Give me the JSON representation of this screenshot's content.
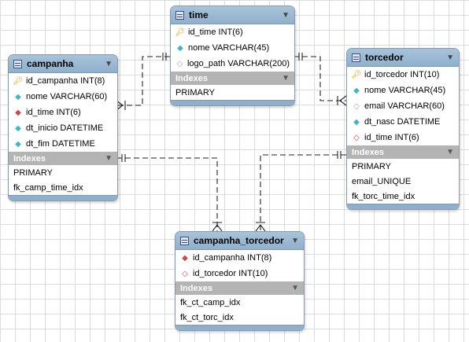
{
  "tables": {
    "time": {
      "name": "time",
      "columns": [
        {
          "icon": "primary-key-icon",
          "text": "id_time INT(6)"
        },
        {
          "icon": "not-null-column-icon",
          "text": "nome VARCHAR(45)"
        },
        {
          "icon": "nullable-column-icon",
          "text": "logo_path VARCHAR(200)"
        }
      ],
      "indexes_label": "Indexes",
      "indexes": [
        "PRIMARY"
      ]
    },
    "campanha": {
      "name": "campanha",
      "columns": [
        {
          "icon": "primary-key-icon",
          "text": "id_campanha INT(8)"
        },
        {
          "icon": "not-null-column-icon",
          "text": "nome VARCHAR(60)"
        },
        {
          "icon": "foreign-key-icon",
          "text": "id_time INT(6)"
        },
        {
          "icon": "not-null-column-icon",
          "text": "dt_inicio DATETIME"
        },
        {
          "icon": "not-null-column-icon",
          "text": "dt_fim DATETIME"
        }
      ],
      "indexes_label": "Indexes",
      "indexes": [
        "PRIMARY",
        "fk_camp_time_idx"
      ]
    },
    "torcedor": {
      "name": "torcedor",
      "columns": [
        {
          "icon": "primary-key-icon",
          "text": "id_torcedor INT(10)"
        },
        {
          "icon": "not-null-column-icon",
          "text": "nome VARCHAR(45)"
        },
        {
          "icon": "nullable-column-icon",
          "text": "email VARCHAR(60)"
        },
        {
          "icon": "not-null-column-icon",
          "text": "dt_nasc DATETIME"
        },
        {
          "icon": "nullable-foreign-key-icon",
          "text": "id_time INT(6)"
        }
      ],
      "indexes_label": "Indexes",
      "indexes": [
        "PRIMARY",
        "email_UNIQUE",
        "fk_torc_time_idx"
      ]
    },
    "campanha_torcedor": {
      "name": "campanha_torcedor",
      "columns": [
        {
          "icon": "foreign-key-icon",
          "text": "id_campanha INT(8)"
        },
        {
          "icon": "nullable-foreign-key-icon",
          "text": "id_torcedor INT(10)"
        }
      ],
      "indexes_label": "Indexes",
      "indexes": [
        "fk_ct_camp_idx",
        "fk_ct_torc_idx"
      ]
    }
  }
}
